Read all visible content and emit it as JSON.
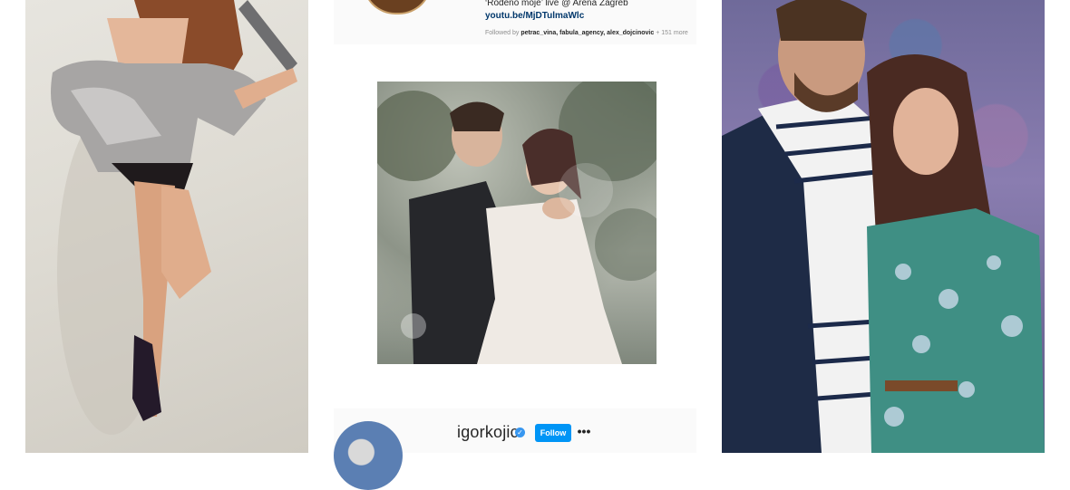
{
  "collage": {
    "left_photo_alt": "",
    "right_photo_alt": ""
  },
  "instagram_top": {
    "bio_text": "‘Rođeno moje’ live @ Arena Zagreb",
    "bio_link": "youtu.be/MjDTulmaWlc",
    "followed_by_prefix": "Followed by",
    "followed_by_names": "petrac_vina, fabula_agency, alex_dojcinovic",
    "followed_by_more": "+ 151 more"
  },
  "instagram_bottom": {
    "username": "igorkojic",
    "follow_label": "Follow",
    "more_label": "•••"
  },
  "colors": {
    "follow_blue": "#0095f6",
    "link_blue": "#00376b",
    "verified_blue": "#3897f0"
  }
}
